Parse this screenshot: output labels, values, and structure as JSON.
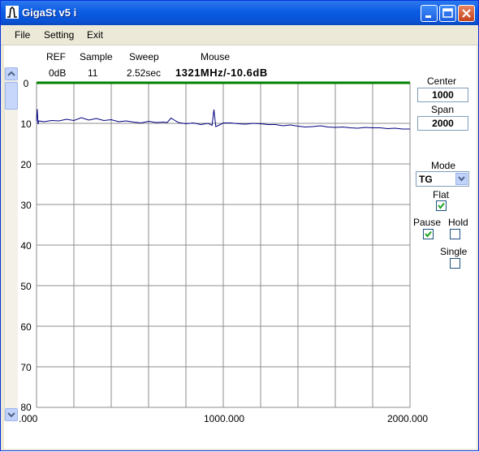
{
  "window": {
    "title": "GigaSt v5 i"
  },
  "menu": {
    "items": [
      "File",
      "Setting",
      "Exit"
    ]
  },
  "header": {
    "ref_label": "REF",
    "ref_value": "0dB",
    "sample_label": "Sample",
    "sample_value": "11",
    "sweep_label": "Sweep",
    "sweep_value": "2.52sec",
    "mouse_label": "Mouse",
    "mouse_value": "1321MHz/-10.6dB"
  },
  "controls": {
    "center_label": "Center",
    "center_value": "1000",
    "span_label": "Span",
    "span_value": "2000",
    "mode_label": "Mode",
    "mode_value": "TG",
    "flat_label": "Flat",
    "flat_checked": true,
    "pause_label": "Pause",
    "pause_checked": true,
    "hold_label": "Hold",
    "hold_checked": false,
    "single_label": "Single",
    "single_checked": false
  },
  "colors": {
    "trace": "#000080",
    "reference_line": "#008000",
    "grid": "#8c8c8c",
    "title_bar": "#0a52d4"
  },
  "chart_data": {
    "type": "line",
    "y_tick_labels": [
      "0",
      "10",
      "20",
      "30",
      "40",
      "50",
      "60",
      "70",
      "80"
    ],
    "x_tick_labels": [
      ".000",
      "1000.000",
      "2000.000"
    ],
    "xlim": [
      0,
      2000
    ],
    "ylim": [
      0,
      80
    ],
    "y_inverted": true,
    "grid": true,
    "reference_level": 0,
    "series": [
      {
        "x": [
          0,
          4,
          8,
          12,
          40,
          80,
          120,
          160,
          200,
          240,
          280,
          320,
          360,
          400,
          440,
          480,
          520,
          560,
          600,
          640,
          680,
          700,
          720,
          760,
          800,
          840,
          880,
          920,
          940,
          950,
          960,
          980,
          1000,
          1040,
          1080,
          1120,
          1160,
          1200,
          1240,
          1280,
          1320,
          1360,
          1400,
          1440,
          1480,
          1520,
          1560,
          1600,
          1640,
          1680,
          1720,
          1760,
          1800,
          1840,
          1880,
          1920,
          1960,
          2000
        ],
        "y": [
          9.5,
          6.5,
          10.2,
          9.4,
          9.6,
          9.3,
          9.4,
          9.0,
          9.3,
          8.6,
          9.2,
          8.8,
          9.3,
          9.1,
          9.6,
          9.4,
          9.7,
          9.9,
          9.5,
          9.8,
          9.7,
          9.8,
          8.7,
          9.8,
          10.1,
          9.9,
          10.3,
          10.0,
          10.5,
          6.6,
          10.8,
          10.4,
          9.9,
          9.9,
          10.1,
          10.2,
          10.0,
          10.1,
          10.3,
          10.3,
          10.6,
          10.4,
          10.7,
          10.9,
          10.8,
          10.6,
          10.9,
          11.0,
          10.9,
          11.1,
          11.2,
          11.0,
          11.1,
          11.1,
          11.3,
          11.2,
          11.4,
          11.4
        ]
      }
    ]
  }
}
